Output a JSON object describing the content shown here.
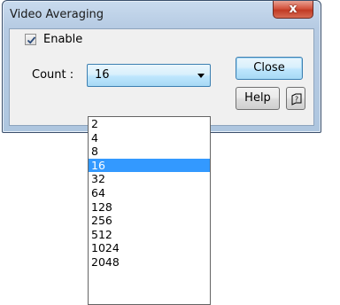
{
  "window": {
    "title": "Video Averaging",
    "close_glyph": "x"
  },
  "enable": {
    "label": "Enable",
    "checked": true
  },
  "count": {
    "label": "Count :",
    "selected": "16",
    "options": [
      "2",
      "4",
      "8",
      "16",
      "32",
      "64",
      "128",
      "256",
      "512",
      "1024",
      "2048"
    ]
  },
  "buttons": {
    "close_label": "Close",
    "help_label": "Help",
    "context_help_icon": "context-help-icon"
  },
  "colors": {
    "selection": "#3399ff",
    "titlebar": "#b6cbe3",
    "close_button": "#c13b24"
  }
}
